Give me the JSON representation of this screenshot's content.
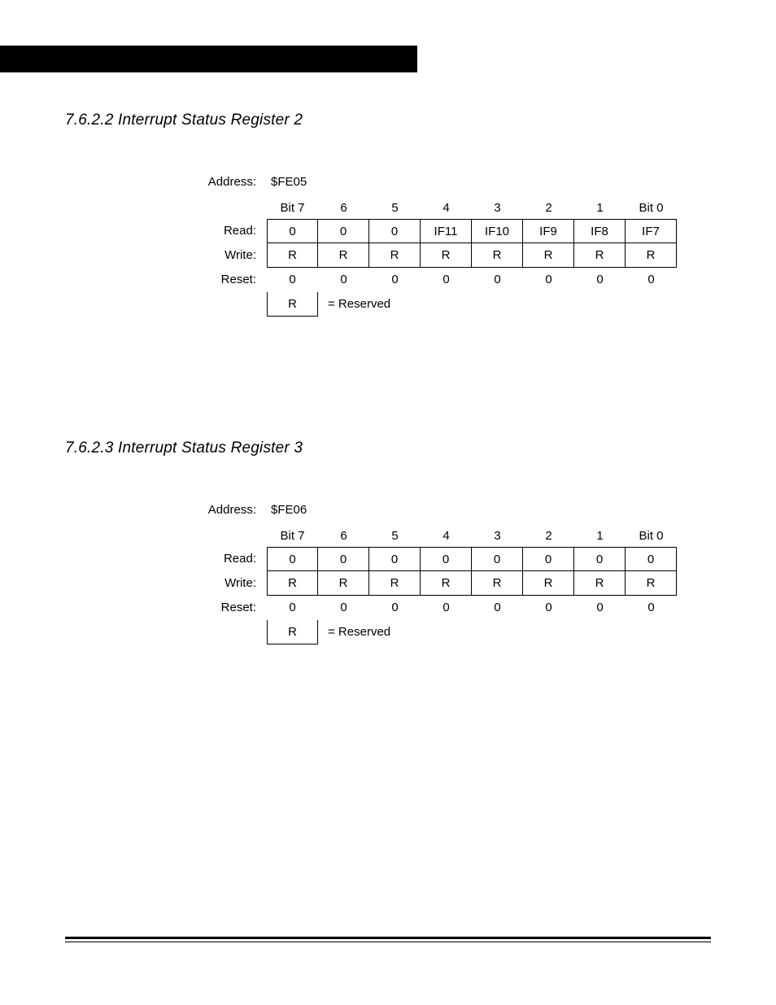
{
  "sections": {
    "s1": "7.6.2.2  Interrupt Status Register 2",
    "s2": "7.6.2.3  Interrupt Status Register 3"
  },
  "labels": {
    "address": "Address:",
    "read": "Read:",
    "write": "Write:",
    "reset": "Reset:",
    "reserved": "= Reserved",
    "r": "R"
  },
  "bit_headers": [
    "Bit 7",
    "6",
    "5",
    "4",
    "3",
    "2",
    "1",
    "Bit 0"
  ],
  "reg2": {
    "address": "$FE05",
    "read": [
      "0",
      "0",
      "0",
      "IF11",
      "IF10",
      "IF9",
      "IF8",
      "IF7"
    ],
    "write": [
      "R",
      "R",
      "R",
      "R",
      "R",
      "R",
      "R",
      "R"
    ],
    "reset": [
      "0",
      "0",
      "0",
      "0",
      "0",
      "0",
      "0",
      "0"
    ]
  },
  "reg3": {
    "address": "$FE06",
    "read": [
      "0",
      "0",
      "0",
      "0",
      "0",
      "0",
      "0",
      "0"
    ],
    "write": [
      "R",
      "R",
      "R",
      "R",
      "R",
      "R",
      "R",
      "R"
    ],
    "reset": [
      "0",
      "0",
      "0",
      "0",
      "0",
      "0",
      "0",
      "0"
    ]
  }
}
